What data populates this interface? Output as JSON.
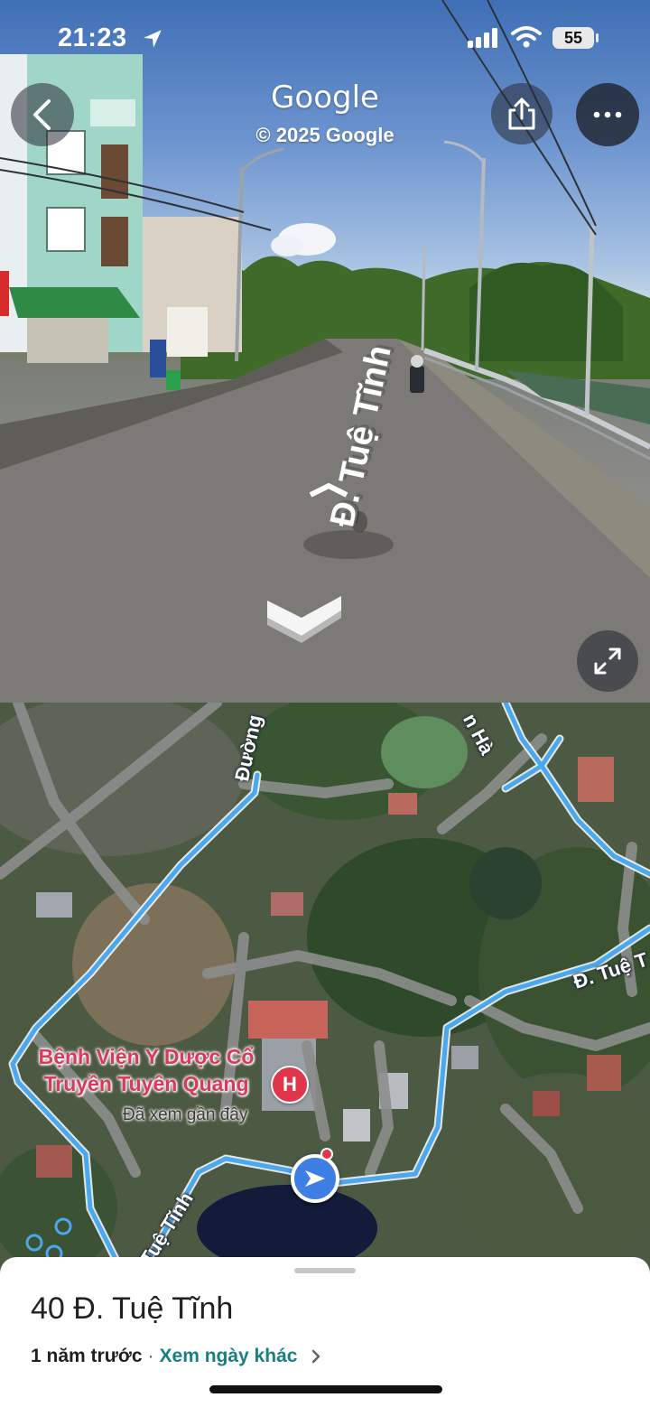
{
  "status_bar": {
    "time": "21:23",
    "battery": "55"
  },
  "street_view": {
    "watermark_title": "Google",
    "watermark_copyright": "© 2025 Google",
    "road_label": "Đ. Tuệ Tĩnh",
    "icons": {
      "back": "chevron-left-icon",
      "share": "share-icon",
      "more": "more-horizontal-icon",
      "expand": "expand-icon",
      "location_services": "location-arrow-icon"
    }
  },
  "map": {
    "labels": {
      "road_top": "Đường",
      "road_top_right": "n Hà",
      "road_east": "Đ. Tuệ T",
      "road_south": "Tuệ Tĩnh"
    },
    "poi": {
      "name": "Bệnh Viện Y Dược Cổ Truyền Tuyên Quang",
      "subtitle": "Đã xem gần đây",
      "pin_letter": "H"
    },
    "colors": {
      "route": "#4aa8f0",
      "poi": "#d73a5e",
      "current_location": "#3d7fe4"
    }
  },
  "sheet": {
    "address": "40 Đ. Tuệ Tĩnh",
    "date_text": "1 năm trước",
    "separator": "·",
    "other_dates_link": "Xem ngày khác"
  }
}
